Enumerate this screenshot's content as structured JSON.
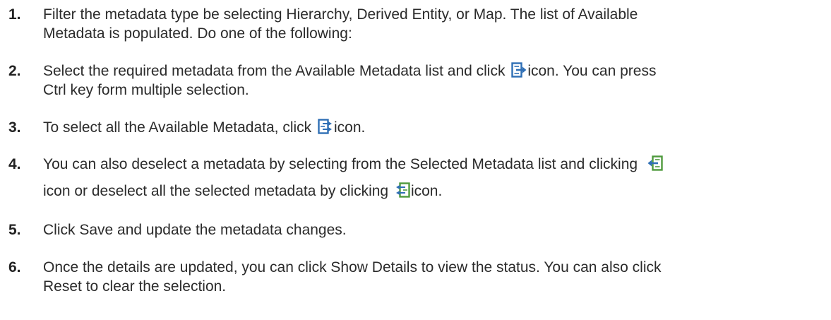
{
  "steps": [
    {
      "number": "1.",
      "lines": [
        "Filter the metadata type be selecting Hierarchy, Derived Entity, or Map. The list of Available",
        "Metadata is populated. Do one of the following:"
      ]
    },
    {
      "number": "2.",
      "line1_before_icon": "Select the required metadata from the Available Metadata list and click ",
      "line1_after_icon": "icon. You can press",
      "line2": "Ctrl key form multiple selection.",
      "icon": "move-selected-right-icon"
    },
    {
      "number": "3.",
      "before_icon": "To select all the Available Metadata, click ",
      "after_icon": "icon.",
      "icon": "move-all-right-icon"
    },
    {
      "number": "4.",
      "line1_before_icon": "You can also deselect a metadata by selecting from the Selected Metadata list and clicking ",
      "line2_before_icon": "icon or deselect all the selected metadata by clicking ",
      "line2_after_icon": "icon.",
      "icon1": "move-selected-left-icon",
      "icon2": "move-all-left-icon"
    },
    {
      "number": "5.",
      "text": "Click Save and update the metadata changes."
    },
    {
      "number": "6.",
      "lines": [
        "Once the details are updated, you can click Show Details to view the status. You can also click",
        "Reset to clear the selection."
      ]
    }
  ],
  "colors": {
    "text": "#2b2b2b",
    "icon_blue": "#2f6fb5",
    "icon_green": "#4e9a3c"
  }
}
